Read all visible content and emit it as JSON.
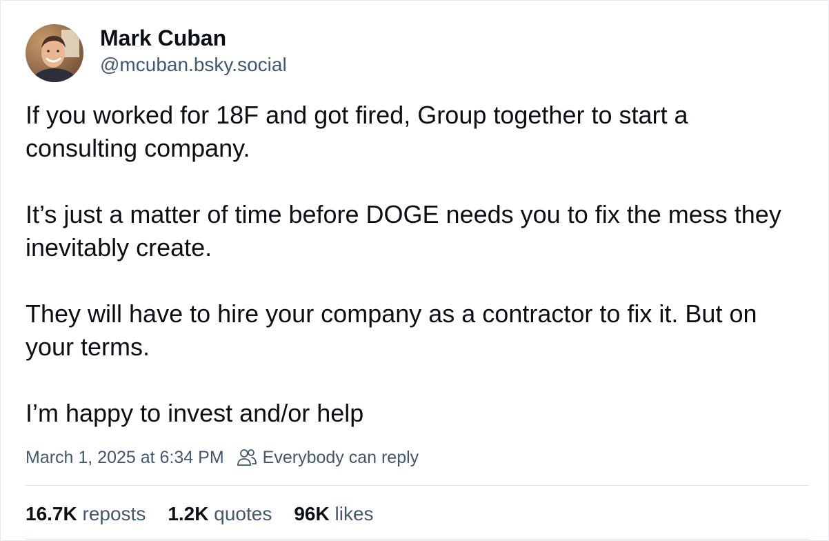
{
  "author": {
    "display_name": "Mark Cuban",
    "handle": "@mcuban.bsky.social",
    "avatar_icon": "avatar-photo"
  },
  "post": {
    "paragraphs": [
      "If you worked for 18F and got fired, Group together to start a consulting company.",
      "It’s just a matter of time before DOGE needs you to fix the mess they inevitably create.",
      "They will have to hire your company as a contractor to fix it. But on your terms.",
      "I’m happy to invest and/or help"
    ]
  },
  "meta": {
    "timestamp": "March 1, 2025 at 6:34 PM",
    "reply_setting": "Everybody can reply",
    "reply_icon": "people-icon"
  },
  "stats": {
    "reposts_count": "16.7K",
    "reposts_label": "reposts",
    "quotes_count": "1.2K",
    "quotes_label": "quotes",
    "likes_count": "96K",
    "likes_label": "likes"
  },
  "colors": {
    "text": "#0b0f14",
    "secondary_text": "#42576c",
    "divider": "#dfe4ea"
  }
}
